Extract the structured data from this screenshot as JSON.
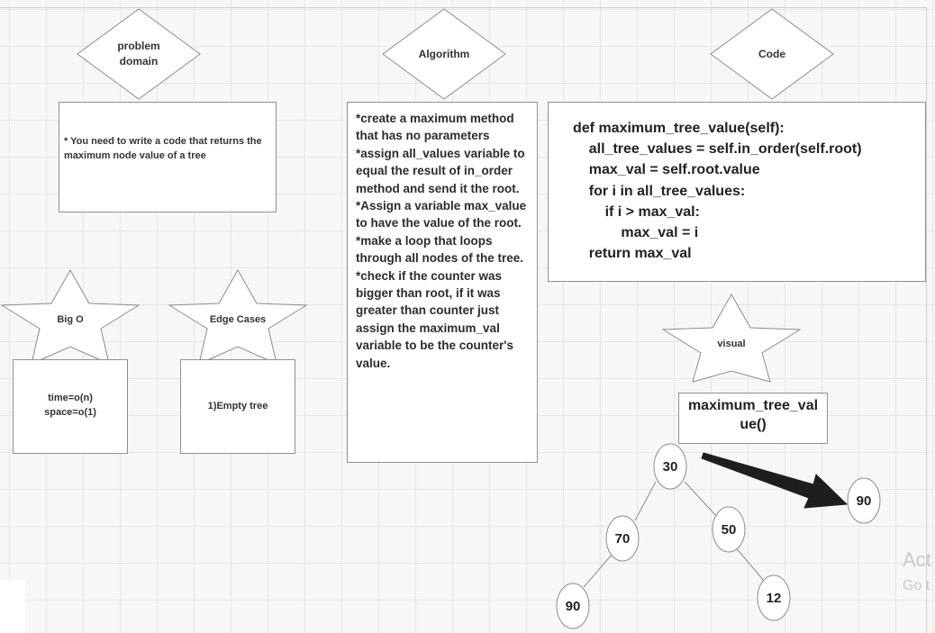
{
  "headers": {
    "problem_domain": "problem domain",
    "algorithm": "Algorithm",
    "code": "Code",
    "big_o": "Big O",
    "edge_cases": "Edge Cases",
    "visual": "visual"
  },
  "problem_domain_text": "* You need to write a code that returns the maximum node value of a tree",
  "algorithm_text": "*create a maximum method that has no parameters\n*assign all_values variable to equal the result of in_order method and send it the root.\n*Assign a variable max_value to have the value of the root.\n*make a loop that loops through all nodes of the tree.\n*check if the counter was bigger than root, if it was greater than counter just assign the maximum_val variable to be the counter's value.",
  "code_text": "def maximum_tree_value(self):\n    all_tree_values = self.in_order(self.root)\n    max_val = self.root.value\n    for i in all_tree_values:\n        if i > max_val:\n            max_val = i\n    return max_val",
  "big_o_text": "time=o(n)\nspace=o(1)",
  "edge_cases_text": "1)Empty tree",
  "visual_box_text": "maximum_tree_val ue()",
  "tree_nodes": {
    "root": "30",
    "left": "70",
    "right": "50",
    "left_left": "90",
    "right_right": "12",
    "result": "90"
  },
  "watermark": {
    "line1": "Act",
    "line2": "Go t"
  },
  "colors": {
    "shape_stroke": "#8c8c8c",
    "arrow": "#1e1e1e",
    "grid": "#e6e6e6",
    "background": "#f7f7f7"
  }
}
